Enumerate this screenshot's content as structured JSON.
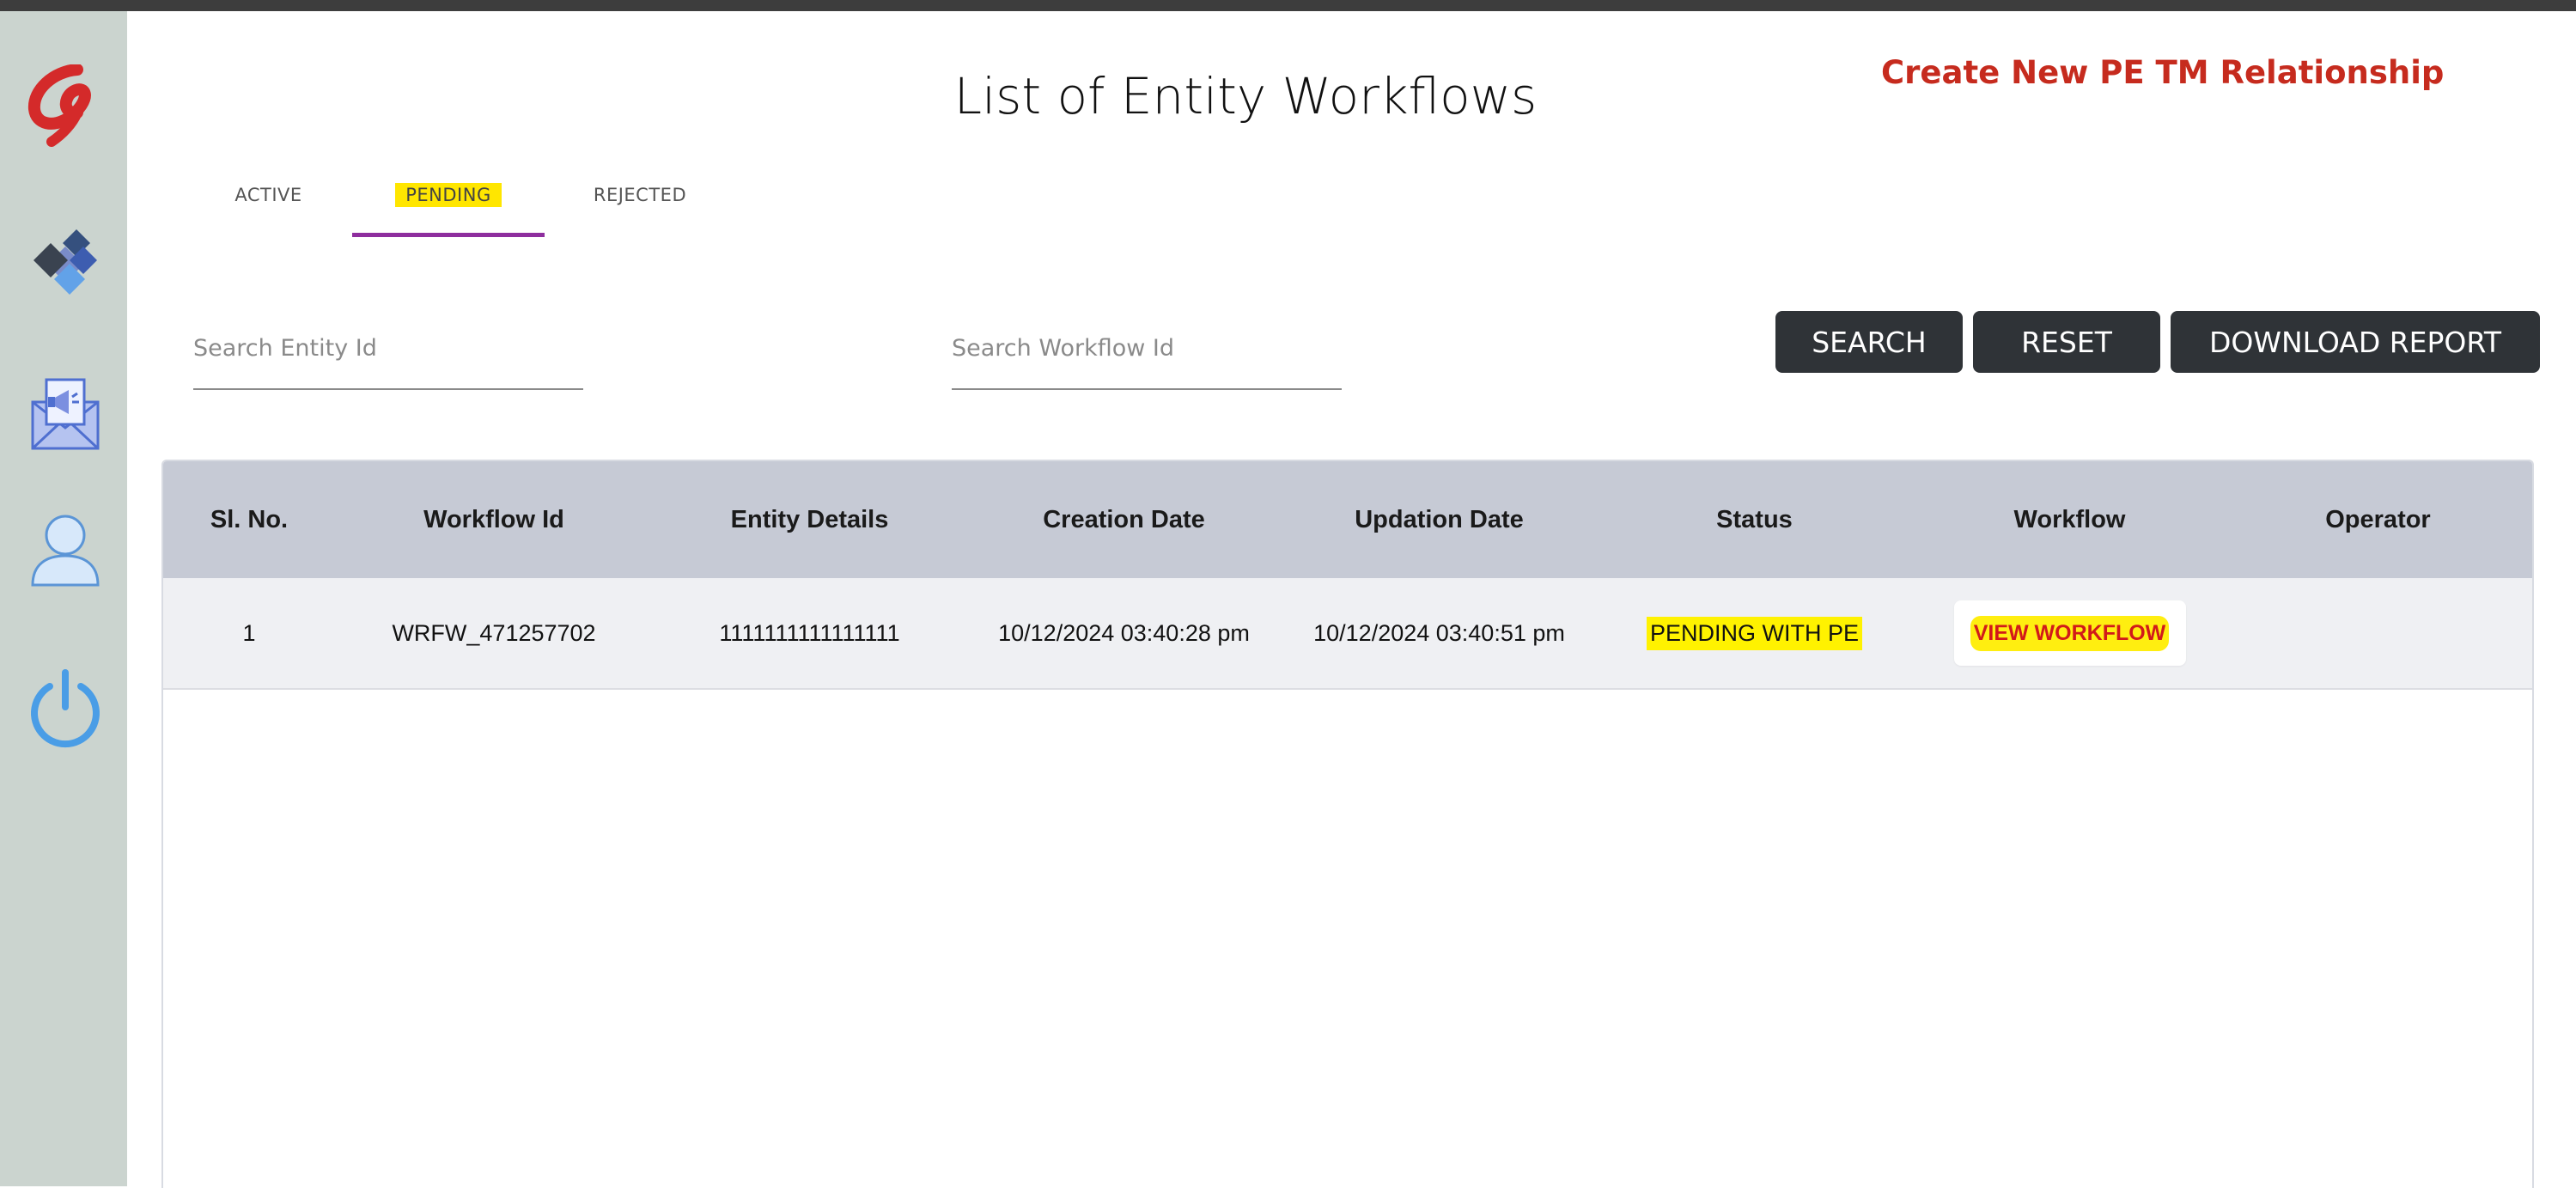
{
  "page_title": "List of Entity Workflows",
  "create_link": "Create New PE TM Relationship",
  "tabs": [
    {
      "label": "ACTIVE"
    },
    {
      "label": "PENDING"
    },
    {
      "label": "REJECTED"
    }
  ],
  "active_tab": "PENDING",
  "search": {
    "entity_placeholder": "Search Entity Id",
    "entity_value": "",
    "workflow_placeholder": "Search Workflow Id",
    "workflow_value": ""
  },
  "buttons": {
    "search": "SEARCH",
    "reset": "RESET",
    "download": "DOWNLOAD REPORT"
  },
  "sidebar": {
    "icons": [
      "airtel-logo-icon",
      "diamond-shapes-icon",
      "mail-megaphone-icon",
      "user-profile-icon",
      "power-icon"
    ]
  },
  "table": {
    "headers": [
      "Sl. No.",
      "Workflow Id",
      "Entity Details",
      "Creation Date",
      "Updation Date",
      "Status",
      "Workflow",
      "Operator"
    ],
    "rows": [
      {
        "sl_no": "1",
        "workflow_id": "WRFW_471257702",
        "entity_details": "1111111111111111",
        "creation_date": "10/12/2024 03:40:28 pm",
        "updation_date": "10/12/2024 03:40:51 pm",
        "status": "PENDING WITH PE",
        "workflow_action": "VIEW WORKFLOW",
        "operator": ""
      }
    ]
  },
  "colors": {
    "accent_tab_underline": "#8e2e9e",
    "create_link": "#c62b1e",
    "button_bg": "#2f3337",
    "highlight": "#ffe600",
    "header_bg": "#c6cad5"
  }
}
